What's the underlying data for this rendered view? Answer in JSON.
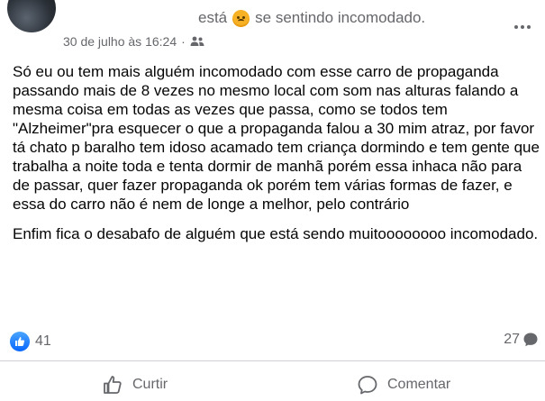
{
  "post": {
    "feeling_pre": "está",
    "feeling_post": "se sentindo incomodado.",
    "date": "30 de julho às 16:24",
    "separator": "·",
    "privacy_icon": "friends-icon",
    "paragraphs": [
      "Só eu ou tem mais alguém incomodado com esse carro de propaganda passando mais de 8 vezes no mesmo local com som nas alturas falando a mesma coisa em todas as vezes que passa, como se todos tem \"Alzheimer\"pra esquecer o que a propaganda falou a 30 mim atraz, por favor tá chato p baralho tem idoso acamado tem criança dormindo e tem gente que trabalha a noite toda e tenta dormir de manhã porém essa inhaca não para de passar, quer fazer propaganda ok porém tem várias formas de fazer, e essa do carro não é nem de longe a melhor, pelo contrário",
      "Enfim fica o desabafo de alguém que está sendo muitoooooooo incomodado."
    ]
  },
  "stats": {
    "reactions_count": "41",
    "comments_count": "27"
  },
  "actions": {
    "like_label": "Curtir",
    "comment_label": "Comentar"
  },
  "colors": {
    "accent": "#0866ff",
    "secondary_text": "#65676b",
    "divider": "#ced0d4"
  }
}
